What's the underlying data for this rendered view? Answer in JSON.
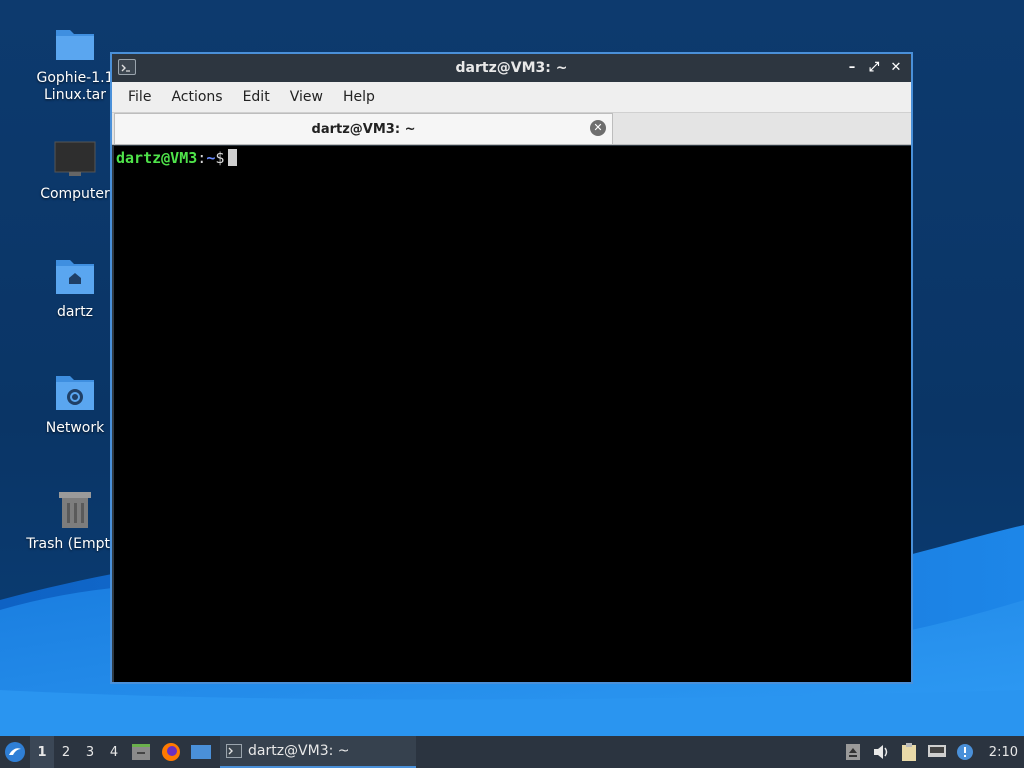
{
  "desktop": {
    "icons": [
      {
        "label_line1": "Gophie-1.1",
        "label_line2": "Linux.tar",
        "icon": "folder-icon"
      },
      {
        "label": "Computer",
        "icon": "monitor-icon"
      },
      {
        "label": "dartz",
        "icon": "home-folder-icon"
      },
      {
        "label": "Network",
        "icon": "network-folder-icon"
      },
      {
        "label": "Trash (Empty)",
        "icon": "trash-icon"
      }
    ]
  },
  "window": {
    "title": "dartz@VM3: ~",
    "buttons": {
      "minimize": "–",
      "maximize": "⤢",
      "close": "✕"
    },
    "menu": [
      "File",
      "Actions",
      "Edit",
      "View",
      "Help"
    ],
    "tab_title": "dartz@VM3: ~",
    "prompt": {
      "user_host": "dartz@VM3",
      "colon": ":",
      "path": "~",
      "symbol": "$"
    }
  },
  "taskbar": {
    "desktops": [
      "1",
      "2",
      "3",
      "4"
    ],
    "active_desktop": "1",
    "task_label": "dartz@VM3: ~",
    "clock": "2:10"
  },
  "colors": {
    "accent": "#4a90d9",
    "prompt_user": "#4fe34a",
    "prompt_path": "#6b8cff"
  }
}
